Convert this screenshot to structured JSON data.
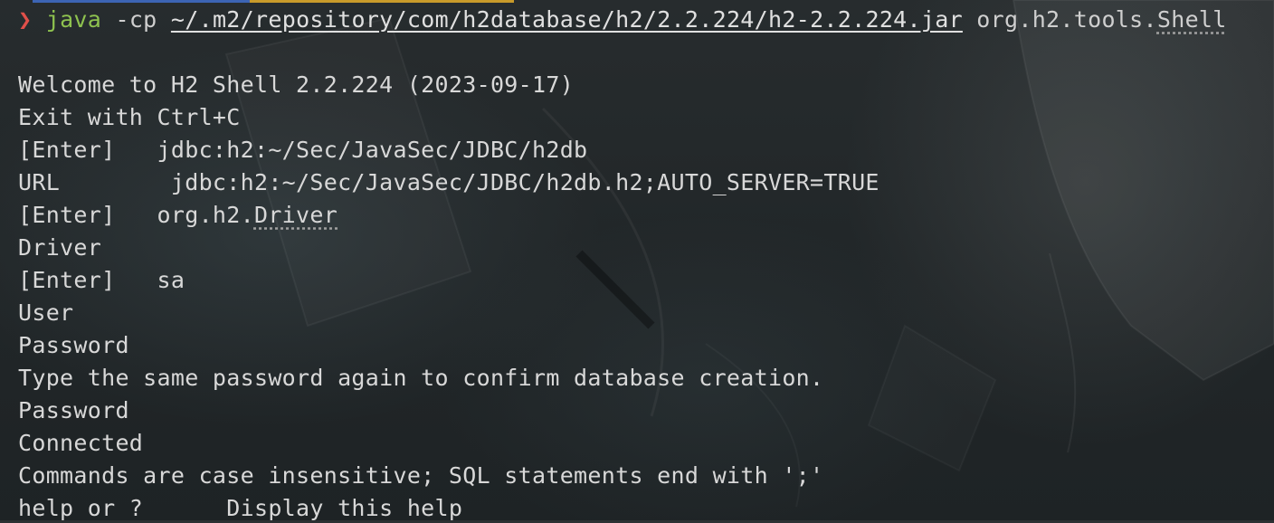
{
  "prompt": {
    "glyph": "❯",
    "command": "java",
    "flag": "-cp",
    "classpath": "~/.m2/repository/com/h2database/h2/2.2.224/h2-2.2.224.jar",
    "main_class_prefix": "org.h2.tools.",
    "main_class_suffix": "Shell"
  },
  "output": {
    "welcome": "Welcome to H2 Shell 2.2.224 (2023-09-17)",
    "exit_hint": "Exit with Ctrl+C",
    "url_default": "[Enter]   jdbc:h2:~/Sec/JavaSec/JDBC/h2db",
    "url_entry": "URL        jdbc:h2:~/Sec/JavaSec/JDBC/h2db.h2;AUTO_SERVER=TRUE",
    "driver_default_prefix": "[Enter]   org.h2.",
    "driver_default_suffix": "Driver",
    "driver_label": "Driver",
    "user_default": "[Enter]   sa",
    "user_label": "User",
    "password_label": "Password",
    "confirm_msg": "Type the same password again to confirm database creation.",
    "password_again": "Password",
    "connected": "Connected",
    "commands_info": "Commands are case insensitive; SQL statements end with ';'",
    "help_line": "help or ?      Display this help"
  },
  "colors": {
    "prompt": "#e0504a",
    "command": "#8ec24f",
    "text": "#d8d8d8",
    "tab_blue": "#3c64b4",
    "tab_amber": "#c89a2a"
  }
}
